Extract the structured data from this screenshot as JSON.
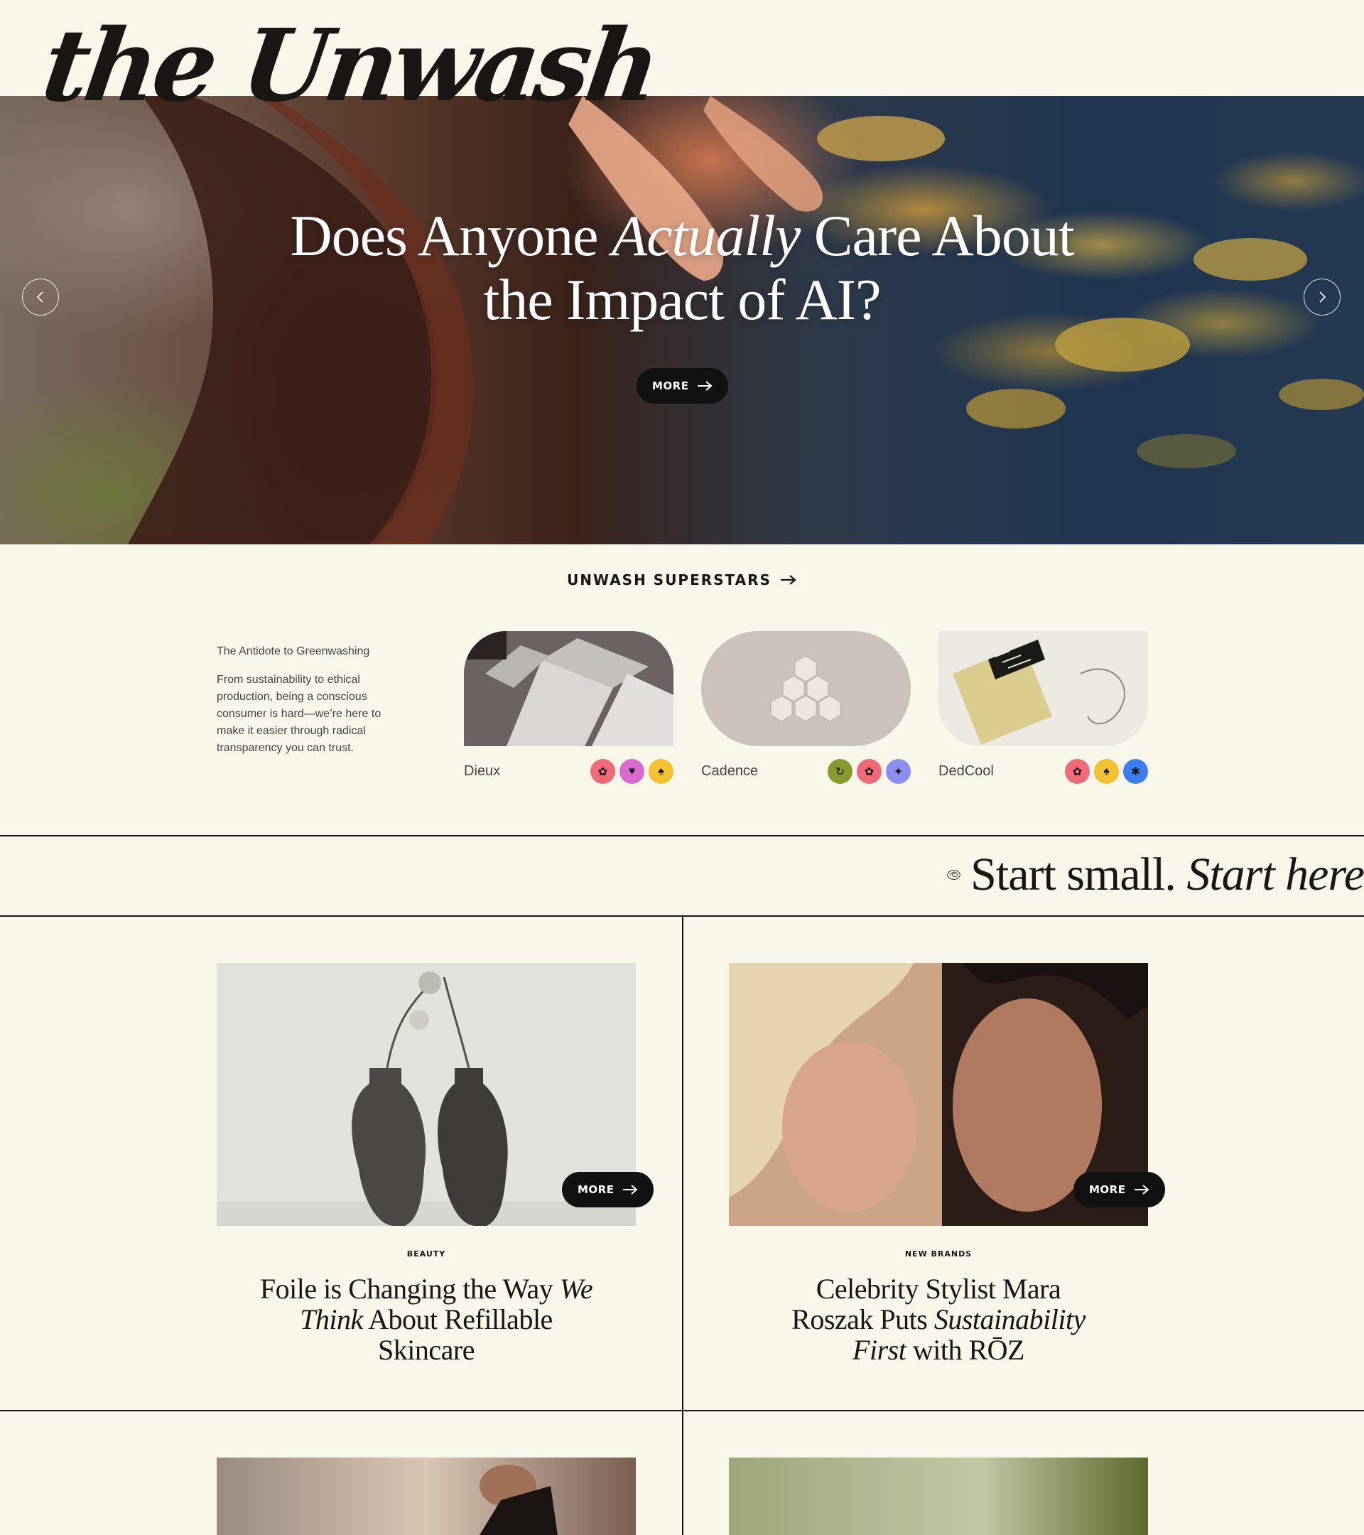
{
  "brand": {
    "logo_text": "the Unwash"
  },
  "search": {
    "placeholder": "Start small. Start here."
  },
  "hero": {
    "title_part1": "Does Anyone ",
    "title_italic": "Actually",
    "title_part2": " Care About",
    "title_line2": "the Impact of AI?",
    "cta_label": "MORE"
  },
  "superstars": {
    "heading": "UNWASH SUPERSTARS",
    "intro_title": "The Antidote to Greenwashing",
    "intro_body": "From sustainability to ethical production, being a conscious consumer is hard—we’re here to make it easier through radical transparency you can trust.",
    "brands": [
      {
        "name": "Dieux",
        "badges": [
          {
            "icon": "lotus-icon",
            "color": "#f06a7a"
          },
          {
            "icon": "heart-icon",
            "color": "#d86ad0"
          },
          {
            "icon": "bunny-icon",
            "color": "#f2c233"
          }
        ]
      },
      {
        "name": "Cadence",
        "badges": [
          {
            "icon": "recycle-icon",
            "color": "#8a9a2e"
          },
          {
            "icon": "lotus-icon",
            "color": "#f06a7a"
          },
          {
            "icon": "sparkle-icon",
            "color": "#8a8ff0"
          }
        ]
      },
      {
        "name": "DedCool",
        "badges": [
          {
            "icon": "lotus-icon",
            "color": "#f06a7a"
          },
          {
            "icon": "bunny-icon",
            "color": "#f2c233"
          },
          {
            "icon": "flower-icon",
            "color": "#3d7ef0"
          }
        ]
      }
    ]
  },
  "marquee": {
    "text": "Start small. ",
    "text_italic": "Start here"
  },
  "articles": [
    {
      "kicker": "BEAUTY",
      "title_a": "Foile is Changing the Way ",
      "title_a_italic": "We",
      "title_b_italic": "Think",
      "title_b": " About Refillable",
      "title_c": "Skincare",
      "cta_label": "MORE"
    },
    {
      "kicker": "NEW BRANDS",
      "title_a": "Celebrity Stylist Mara",
      "title_b": "Roszak Puts ",
      "title_b_italic": "Sustainability",
      "title_c_italic": "First",
      "title_c": " with RŌZ",
      "cta_label": "MORE"
    }
  ]
}
